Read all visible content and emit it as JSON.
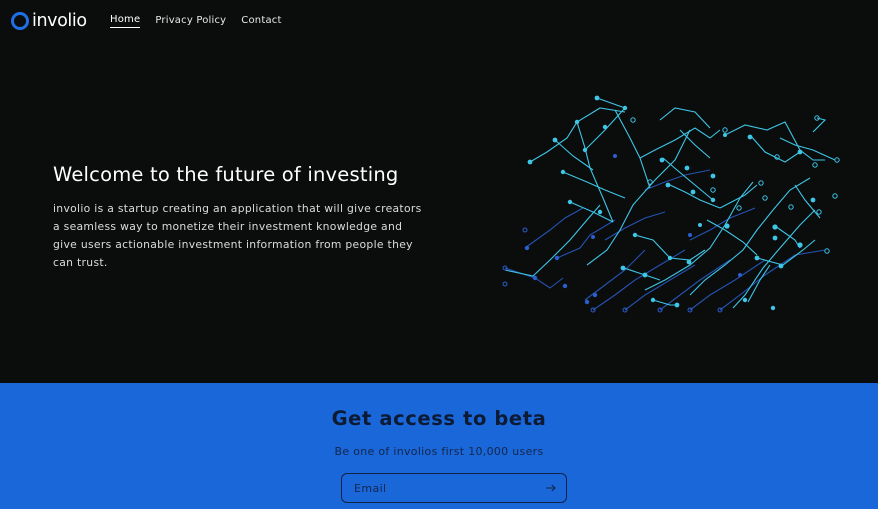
{
  "brand": {
    "name": "involio",
    "accent": "#1f6fe6"
  },
  "nav": {
    "items": [
      {
        "label": "Home",
        "active": true
      },
      {
        "label": "Privacy Policy",
        "active": false
      },
      {
        "label": "Contact",
        "active": false
      }
    ]
  },
  "hero": {
    "title": "Welcome to the future of investing",
    "description": "involio is a startup creating an application that will give creators a seamless way to monetize their investment knowledge and give users actionable investment information from people they can trust."
  },
  "beta": {
    "title": "Get access to beta",
    "subtitle": "Be one of involios first 10,000 users",
    "email_placeholder": "Email",
    "background": "#1a67da",
    "submit_icon": "arrow-right-icon"
  },
  "colors": {
    "page_background": "#0b0c0c",
    "circuit_cyan": "#3ec6e6",
    "circuit_blue": "#2a5fd0"
  }
}
